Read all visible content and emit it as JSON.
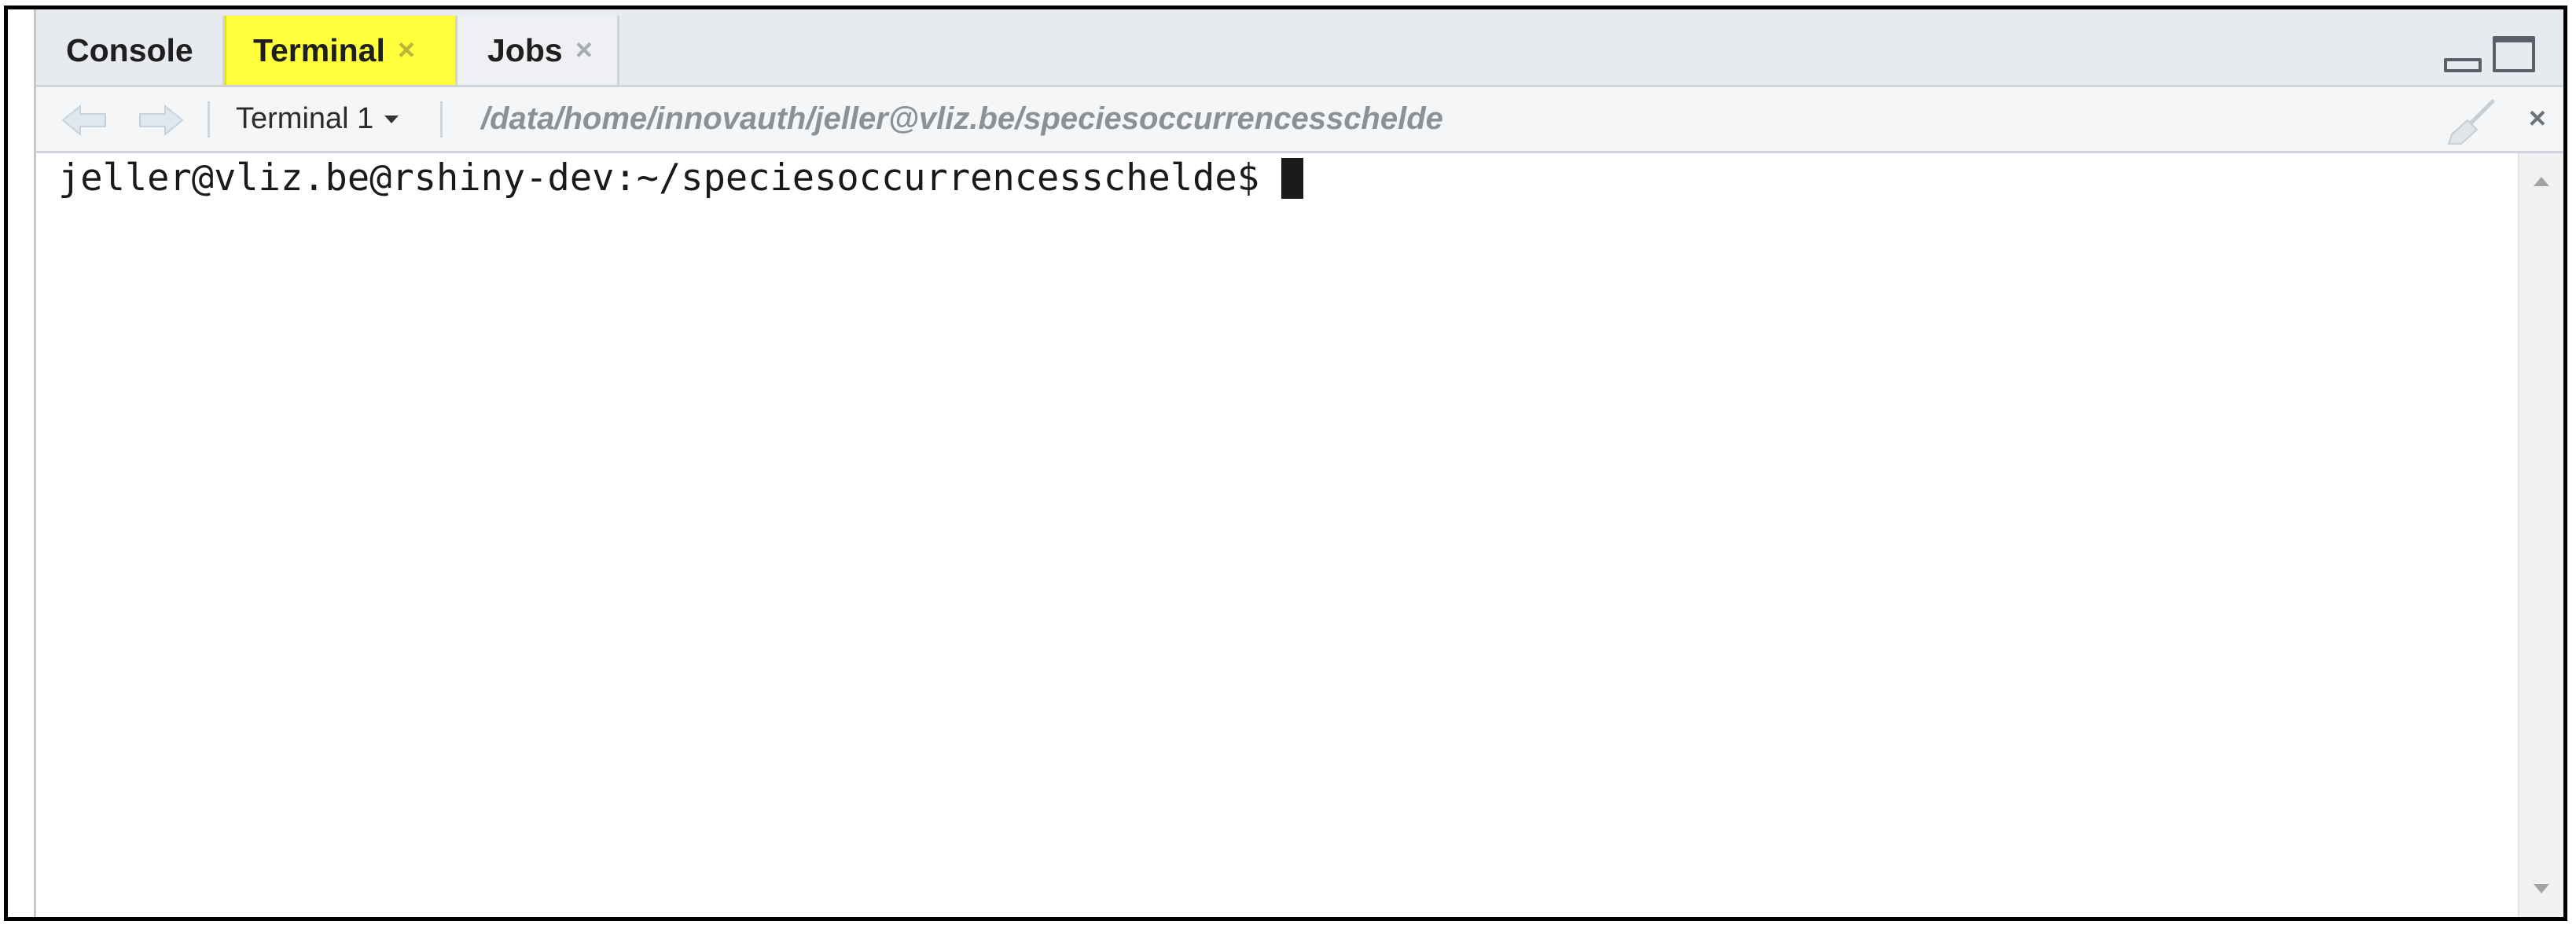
{
  "tabs": [
    {
      "label": "Console",
      "closable": false
    },
    {
      "label": "Terminal",
      "closable": true,
      "highlighted": true,
      "highlight_color": "#ffff3c"
    },
    {
      "label": "Jobs",
      "closable": true
    }
  ],
  "tab_close_glyph": "×",
  "window_controls": {
    "minimize": "minimize-icon",
    "maximize": "maximize-icon"
  },
  "toolbar": {
    "back_icon": "arrow-left-icon",
    "forward_icon": "arrow-right-icon",
    "terminal_select": "Terminal 1",
    "path": "/data/home/innovauth/jeller@vliz.be/speciesoccurrencesschelde",
    "clear_icon": "broom-icon",
    "close_glyph": "×"
  },
  "terminal": {
    "prompt": "jeller@vliz.be@rshiny-dev:~/speciesoccurrencesschelde$"
  }
}
